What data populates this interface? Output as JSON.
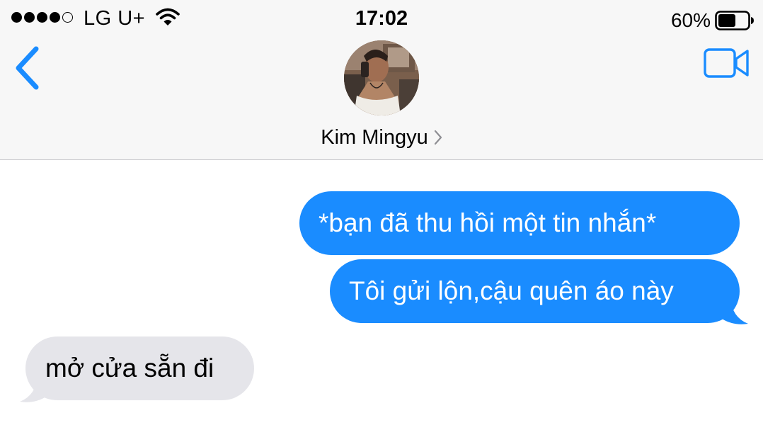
{
  "status_bar": {
    "signal_bars_filled": 4,
    "signal_bars_total": 5,
    "carrier": "LG U+",
    "time": "17:02",
    "battery_percent": "60%",
    "battery_level": 0.6
  },
  "header": {
    "contact_name": "Kim Mingyu",
    "back_icon": "chevron-left-icon",
    "video_icon": "video-camera-icon",
    "accent_color": "#1a8cff"
  },
  "messages": [
    {
      "direction": "sent",
      "text": "*bạn đã thu hồi một tin nhắn*"
    },
    {
      "direction": "sent",
      "text": "Tôi gửi lộn,cậu quên áo này"
    },
    {
      "direction": "received",
      "text": "mở cửa sẵn đi"
    }
  ],
  "colors": {
    "sent_bubble": "#1a8cff",
    "received_bubble": "#e5e5ea",
    "header_bg": "#f7f7f7"
  }
}
